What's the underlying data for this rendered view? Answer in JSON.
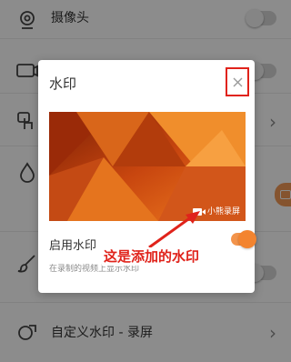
{
  "background": {
    "rows": [
      {
        "label": "摄像头",
        "icon": "webcam-icon",
        "control": "toggle-off"
      },
      {
        "label": "",
        "icon": "gif-icon",
        "control": "toggle-off"
      },
      {
        "label": "",
        "icon": "touch-icon",
        "control": "chevron"
      },
      {
        "label": "",
        "icon": "drop-icon",
        "control": "none"
      },
      {
        "label": "",
        "icon": "brush-icon",
        "control": "toggle-off"
      },
      {
        "label": "自定义水印 - 录屏",
        "icon": "watermark-icon",
        "control": "chevron"
      }
    ],
    "chevron_glyph": "›"
  },
  "dialog": {
    "title": "水印",
    "close_icon": "close-icon",
    "preview": {
      "watermark_text": "小熊录屏",
      "watermark_icon": "video-camera-icon"
    },
    "enable_label": "启用水印",
    "enable_description": "在录制的视频上显示水印",
    "enabled": true
  },
  "annotation": {
    "text": "这是添加的水印",
    "color": "#e0231b"
  },
  "colors": {
    "accent_orange": "#f3842f",
    "annotation_red": "#e0231b",
    "overlay": "rgba(0,0,0,0.45)"
  }
}
